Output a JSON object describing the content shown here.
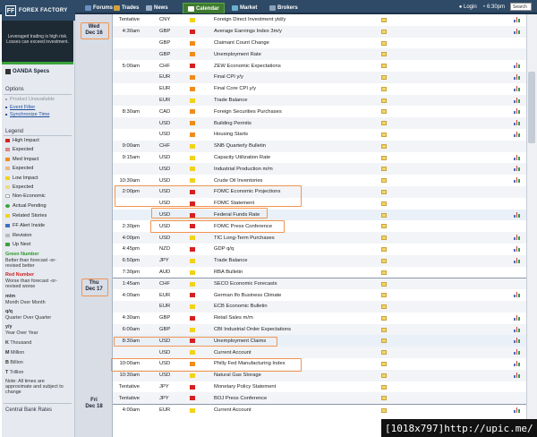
{
  "topbar": {
    "logo_text": "FOREX FACTORY",
    "tabs": [
      {
        "label": "Forums",
        "active": false
      },
      {
        "label": "Trades",
        "active": false
      },
      {
        "label": "News",
        "active": false
      },
      {
        "label": "Calendar",
        "active": true
      },
      {
        "label": "Market",
        "active": false
      },
      {
        "label": "Brokers",
        "active": false
      }
    ],
    "login": "Login",
    "time": "6:30pm",
    "search_value": "Search"
  },
  "sidebar": {
    "ad_text": "Leveraged trading is high risk. Losses can exceed investment.",
    "oanda_label": "OANDA Specs",
    "options_header": "Options",
    "options": [
      {
        "label": "Product Unavailable",
        "enabled": false
      },
      {
        "label": "Event Filter",
        "enabled": true
      },
      {
        "label": "Synchronize Time",
        "enabled": true
      }
    ],
    "legend_header": "Legend",
    "legend": [
      {
        "label": "High Impact",
        "color": "red"
      },
      {
        "label": "Expected",
        "color": "white"
      },
      {
        "label": "Med Impact",
        "color": "orange"
      },
      {
        "label": "Expected",
        "color": "white"
      },
      {
        "label": "Low Impact",
        "color": "yellow"
      },
      {
        "label": "Expected",
        "color": "white"
      },
      {
        "label": "Non-Economic",
        "color": "white"
      },
      {
        "label": "Actual Pending",
        "color": "green"
      },
      {
        "label": "Related Stories",
        "color": "yellow"
      },
      {
        "label": "FF Alert Inside",
        "color": "blue"
      },
      {
        "label": "Revision",
        "color": "gray"
      },
      {
        "label": "Up Next",
        "color": "green"
      }
    ],
    "green_title": "Green Number",
    "green_desc": "Better than forecast -or- revised better",
    "red_title": "Red Number",
    "red_desc": "Worse than forecast -or- revised worse",
    "abbrev": [
      {
        "key": "m/m",
        "desc": "Month Over Month"
      },
      {
        "key": "q/q",
        "desc": "Quarter Over Quarter"
      },
      {
        "key": "y/y",
        "desc": "Year Over Year"
      },
      {
        "key": "K",
        "desc": "Thousand"
      },
      {
        "key": "M",
        "desc": "Million"
      },
      {
        "key": "B",
        "desc": "Billion"
      },
      {
        "key": "T",
        "desc": "Trillion"
      }
    ],
    "footnote": "Note: All times are approximate and subject to change",
    "central_banks_header": "Central Bank Rates"
  },
  "days": [
    {
      "day": "Wed",
      "date": "Dec 16"
    },
    {
      "day": "Thu",
      "date": "Dec 17"
    },
    {
      "day": "Fri",
      "date": "Dec 18"
    }
  ],
  "events": [
    {
      "time": "Tentative",
      "cur": "CNY",
      "impact": "low",
      "event": "Foreign Direct Investment ytd/y",
      "chart": true
    },
    {
      "time": "4:30am",
      "cur": "GBP",
      "impact": "high",
      "event": "Average Earnings Index 3m/y",
      "chart": true
    },
    {
      "time": "",
      "cur": "GBP",
      "impact": "med",
      "event": "Claimant Count Change",
      "chart": false
    },
    {
      "time": "",
      "cur": "GBP",
      "impact": "med",
      "event": "Unemployment Rate",
      "chart": false
    },
    {
      "time": "5:00am",
      "cur": "CHF",
      "impact": "high",
      "event": "ZEW Economic Expectations",
      "chart": true
    },
    {
      "time": "",
      "cur": "EUR",
      "impact": "med",
      "event": "Final CPI y/y",
      "chart": true
    },
    {
      "time": "",
      "cur": "EUR",
      "impact": "med",
      "event": "Final Core CPI y/y",
      "chart": true
    },
    {
      "time": "",
      "cur": "EUR",
      "impact": "low",
      "event": "Trade Balance",
      "chart": true
    },
    {
      "time": "8:30am",
      "cur": "CAD",
      "impact": "med",
      "event": "Foreign Securities Purchases",
      "chart": true
    },
    {
      "time": "",
      "cur": "USD",
      "impact": "med",
      "event": "Building Permits",
      "chart": true
    },
    {
      "time": "",
      "cur": "USD",
      "impact": "med",
      "event": "Housing Starts",
      "chart": true
    },
    {
      "time": "9:00am",
      "cur": "CHF",
      "impact": "low",
      "event": "SNB Quarterly Bulletin",
      "chart": false
    },
    {
      "time": "9:15am",
      "cur": "USD",
      "impact": "low",
      "event": "Capacity Utilization Rate",
      "chart": true
    },
    {
      "time": "",
      "cur": "USD",
      "impact": "low",
      "event": "Industrial Production m/m",
      "chart": true
    },
    {
      "time": "10:30am",
      "cur": "USD",
      "impact": "low",
      "event": "Crude Oil Inventories",
      "chart": true
    },
    {
      "time": "2:00pm",
      "cur": "USD",
      "impact": "high",
      "event": "FOMC Economic Projections",
      "chart": false
    },
    {
      "time": "",
      "cur": "USD",
      "impact": "high",
      "event": "FOMC Statement",
      "chart": false
    },
    {
      "time": "",
      "cur": "USD",
      "impact": "high",
      "event": "Federal Funds Rate",
      "chart": true
    },
    {
      "time": "2:30pm",
      "cur": "USD",
      "impact": "high",
      "event": "FOMC Press Conference",
      "chart": false
    },
    {
      "time": "4:00pm",
      "cur": "USD",
      "impact": "low",
      "event": "TIC Long-Term Purchases",
      "chart": true
    },
    {
      "time": "4:45pm",
      "cur": "NZD",
      "impact": "high",
      "event": "GDP q/q",
      "chart": true
    },
    {
      "time": "6:50pm",
      "cur": "JPY",
      "impact": "low",
      "event": "Trade Balance",
      "chart": true
    },
    {
      "time": "7:30pm",
      "cur": "AUD",
      "impact": "low",
      "event": "RBA Bulletin",
      "chart": false
    },
    {
      "time": "1:45am",
      "cur": "CHF",
      "impact": "low",
      "event": "SECO Economic Forecasts",
      "chart": false
    },
    {
      "time": "4:00am",
      "cur": "EUR",
      "impact": "high",
      "event": "German Ifo Business Climate",
      "chart": true
    },
    {
      "time": "",
      "cur": "EUR",
      "impact": "low",
      "event": "ECB Economic Bulletin",
      "chart": false
    },
    {
      "time": "4:30am",
      "cur": "GBP",
      "impact": "high",
      "event": "Retail Sales m/m",
      "chart": true
    },
    {
      "time": "6:00am",
      "cur": "GBP",
      "impact": "low",
      "event": "CBI Industrial Order Expectations",
      "chart": true
    },
    {
      "time": "8:30am",
      "cur": "USD",
      "impact": "high",
      "event": "Unemployment Claims",
      "chart": true
    },
    {
      "time": "",
      "cur": "USD",
      "impact": "low",
      "event": "Current Account",
      "chart": true
    },
    {
      "time": "10:00am",
      "cur": "USD",
      "impact": "med",
      "event": "Philly Fed Manufacturing Index",
      "chart": true
    },
    {
      "time": "10:30am",
      "cur": "USD",
      "impact": "low",
      "event": "Natural Gas Storage",
      "chart": true
    },
    {
      "time": "Tentative",
      "cur": "JPY",
      "impact": "high",
      "event": "Monetary Policy Statement",
      "chart": false
    },
    {
      "time": "Tentative",
      "cur": "JPY",
      "impact": "high",
      "event": "BOJ Press Conference",
      "chart": false
    },
    {
      "time": "4:00am",
      "cur": "EUR",
      "impact": "low",
      "event": "Current Account",
      "chart": true
    }
  ],
  "watermark": "[1018x797]http://upic.me/"
}
